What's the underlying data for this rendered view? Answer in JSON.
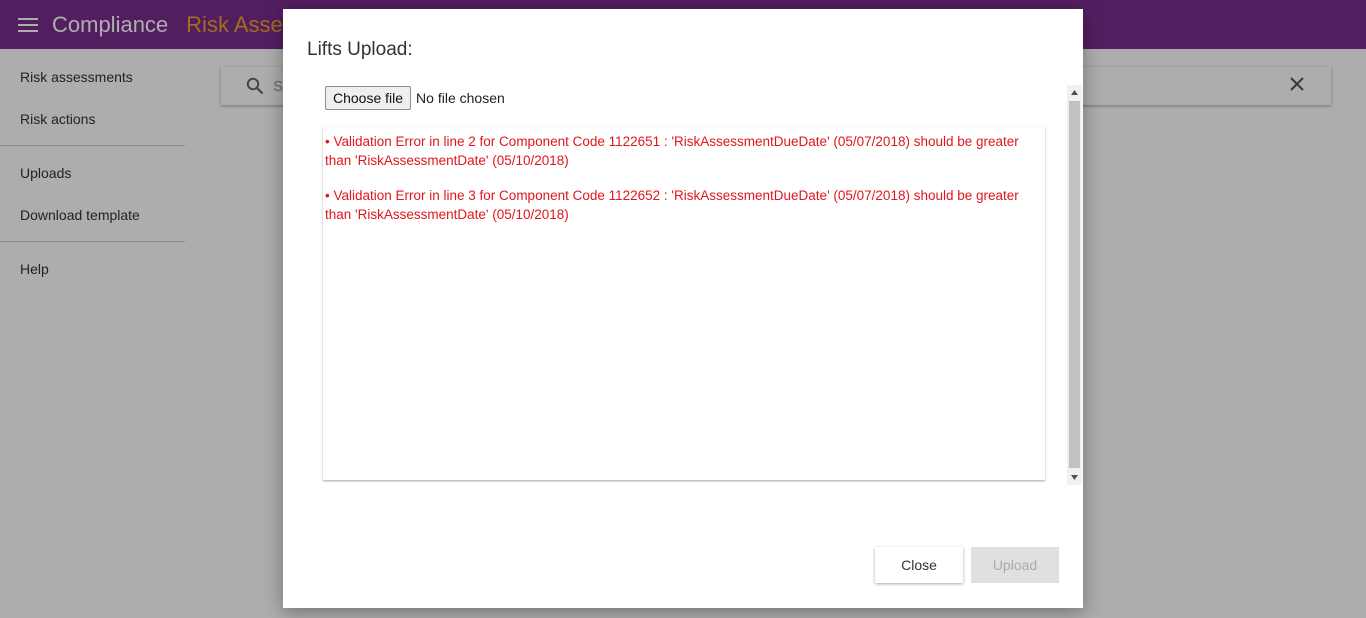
{
  "header": {
    "menu_icon": "hamburger-menu-icon",
    "app_title": "Compliance",
    "section_title": "Risk Assess",
    "colors": {
      "background": "#7b2d8e",
      "app_title": "#ffffff",
      "section_title": "#f0a030"
    }
  },
  "sidebar": {
    "group1": [
      {
        "label": "Risk assessments"
      },
      {
        "label": "Risk actions"
      }
    ],
    "group2": [
      {
        "label": "Uploads"
      },
      {
        "label": "Download template"
      }
    ],
    "group3": [
      {
        "label": "Help"
      }
    ]
  },
  "search": {
    "placeholder": "S",
    "search_icon": "search-icon",
    "clear_icon": "close-icon"
  },
  "dialog": {
    "title": "Lifts Upload:",
    "file_input": {
      "button_label": "Choose file",
      "status": "No file chosen"
    },
    "errors": [
      "• Validation Error in line 2 for Component Code 1122651 : 'RiskAssessmentDueDate' (05/07/2018) should be greater than 'RiskAssessmentDate' (05/10/2018)",
      "• Validation Error in line 3 for Component Code 1122652 : 'RiskAssessmentDueDate' (05/07/2018) should be greater than 'RiskAssessmentDate' (05/10/2018)"
    ],
    "error_color": "#e0161c",
    "actions": {
      "close_label": "Close",
      "upload_label": "Upload",
      "upload_disabled": true
    }
  }
}
